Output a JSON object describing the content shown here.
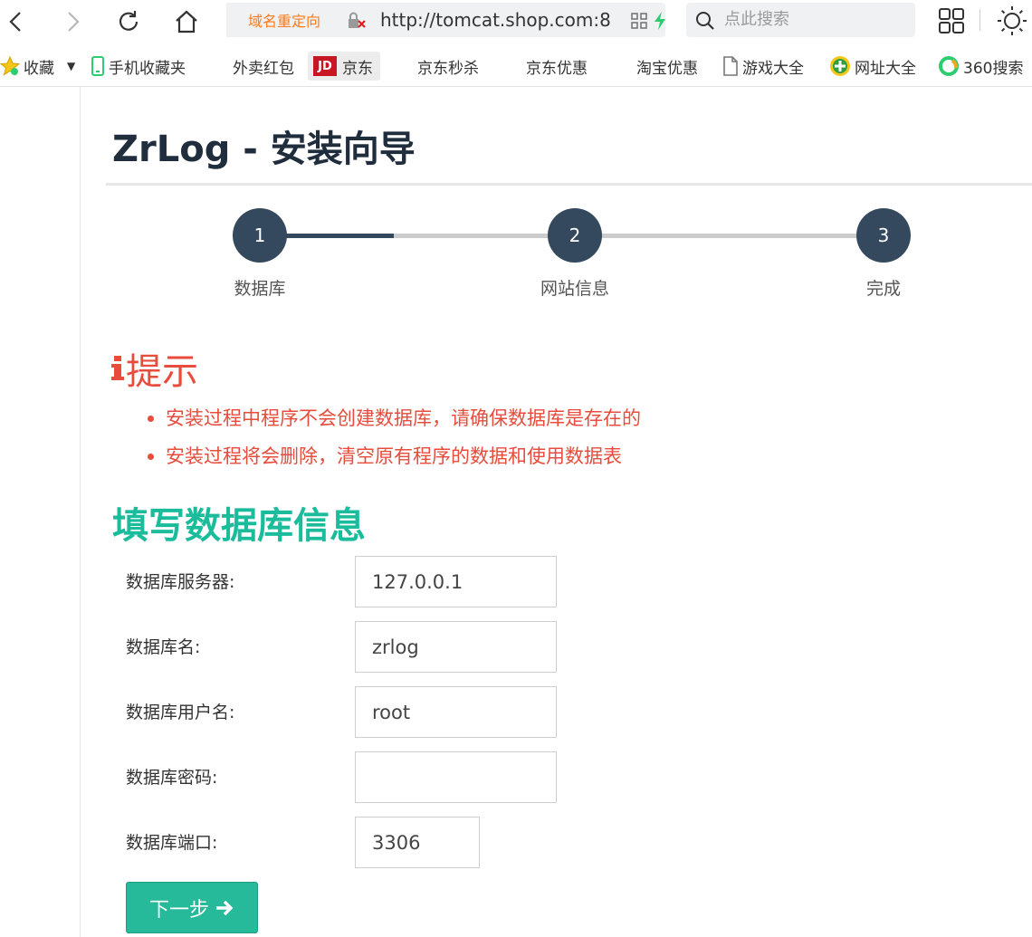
{
  "browser": {
    "redirect_label": "域名重定向",
    "url": "http://tomcat.shop.com:8",
    "search_placeholder": "点此搜索"
  },
  "bookmarks": [
    {
      "label": "收藏"
    },
    {
      "label": "手机收藏夹"
    },
    {
      "label": "外卖红包"
    },
    {
      "label": "京东",
      "logo": "JD"
    },
    {
      "label": "京东秒杀"
    },
    {
      "label": "京东优惠"
    },
    {
      "label": "淘宝优惠"
    },
    {
      "label": "游戏大全"
    },
    {
      "label": "网址大全"
    },
    {
      "label": "360搜索"
    }
  ],
  "page": {
    "title": "ZrLog - 安装向导"
  },
  "steps": [
    {
      "number": "1",
      "label": "数据库"
    },
    {
      "number": "2",
      "label": "网站信息"
    },
    {
      "number": "3",
      "label": "完成"
    }
  ],
  "step_progress": 0.5,
  "notice": {
    "title": "提示",
    "items": [
      "安装过程中程序不会创建数据库，请确保数据库是存在的",
      "安装过程将会删除，清空原有程序的数据和使用数据表"
    ]
  },
  "form": {
    "title": "填写数据库信息",
    "fields": [
      {
        "label": "数据库服务器:",
        "value": "127.0.0.1"
      },
      {
        "label": "数据库名:",
        "value": "zrlog"
      },
      {
        "label": "数据库用户名:",
        "value": "root"
      },
      {
        "label": "数据库密码:",
        "value": ""
      },
      {
        "label": "数据库端口:",
        "value": "3306"
      }
    ],
    "next_label": "下一步"
  },
  "colors": {
    "step_active": "#34495e",
    "step_inactive": "#cccccc",
    "notice": "#e74c3c",
    "form_title": "#1abc9c",
    "button": "#26b99a"
  }
}
